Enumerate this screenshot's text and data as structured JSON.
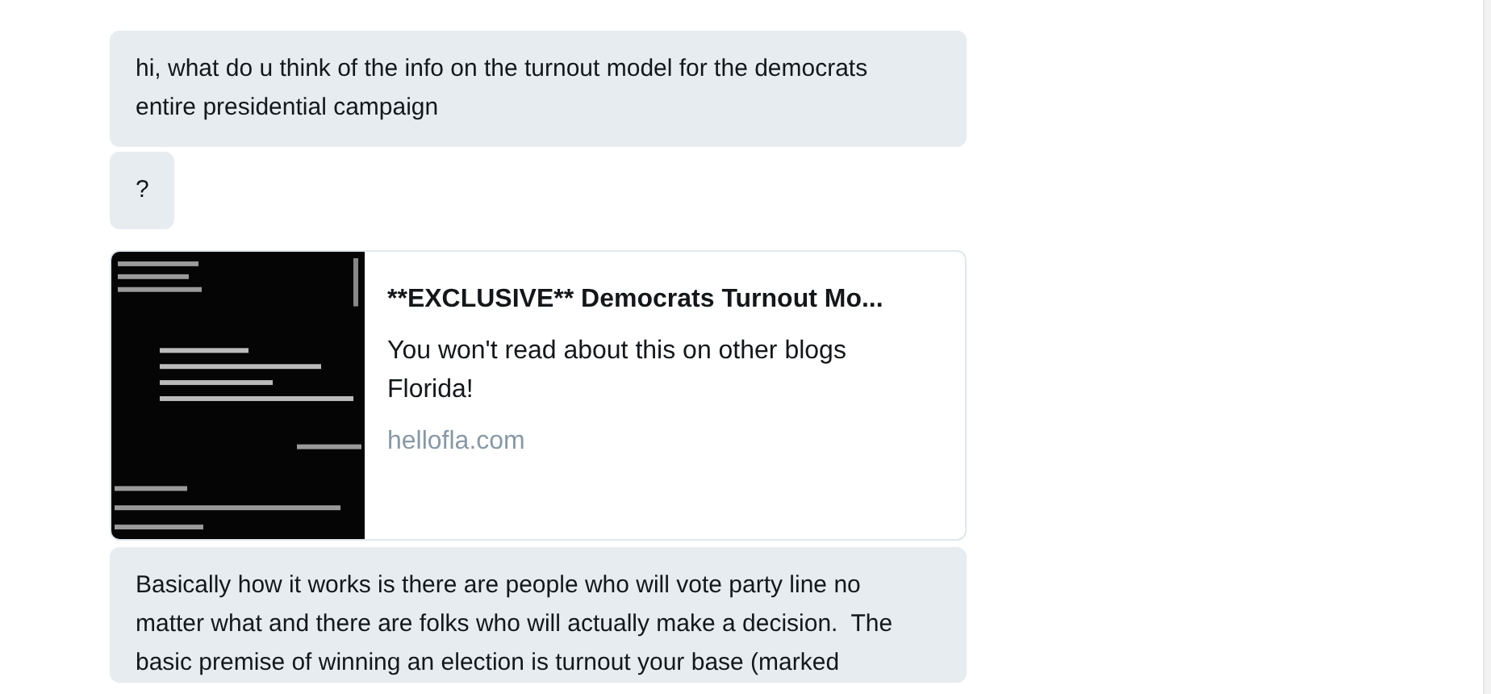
{
  "messages": [
    {
      "kind": "text",
      "text": "hi, what do u think of the info on the turnout model for the democrats entire presidential campaign"
    },
    {
      "kind": "text",
      "text": "?"
    },
    {
      "kind": "link",
      "title": "**EXCLUSIVE** Democrats Turnout Mo...",
      "description": "You won't read about this on other blogs Florida!",
      "domain": "hellofla.com"
    },
    {
      "kind": "text",
      "text": "Basically how it works is there are people who will vote party line no matter what and there are folks who will actually make a decision.  The basic premise of winning an election is turnout your base (marked"
    }
  ]
}
